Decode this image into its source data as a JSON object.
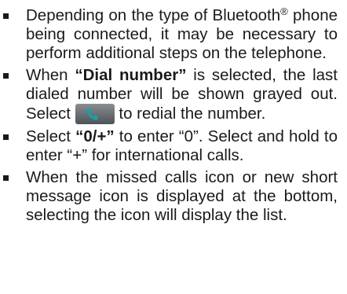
{
  "bullets": [
    {
      "text_before_mark": "Depending on the type of Bluetooth",
      "mark": "®",
      "text_after_mark": " phone being connected, it may be necessary to perform additional steps on the telephone."
    },
    {
      "text_before_bold": "When ",
      "bold": "“Dial number”",
      "text_middle": " is selected, the last dialed number will be shown grayed out. Select ",
      "icon": "phone-handset-icon",
      "text_after_icon": " to redial the number."
    },
    {
      "text_before_bold": "Select ",
      "bold": "“0/+”",
      "text_after_bold": " to enter “0”. Select and hold to enter “+” for international calls."
    },
    {
      "text": "When the missed calls icon or new short message icon is displayed at the bottom, selecting the icon will display the list."
    }
  ],
  "colors": {
    "text": "#1a1a1a",
    "icon_background": "#6b7075",
    "icon_handset": "#18a0a8"
  }
}
